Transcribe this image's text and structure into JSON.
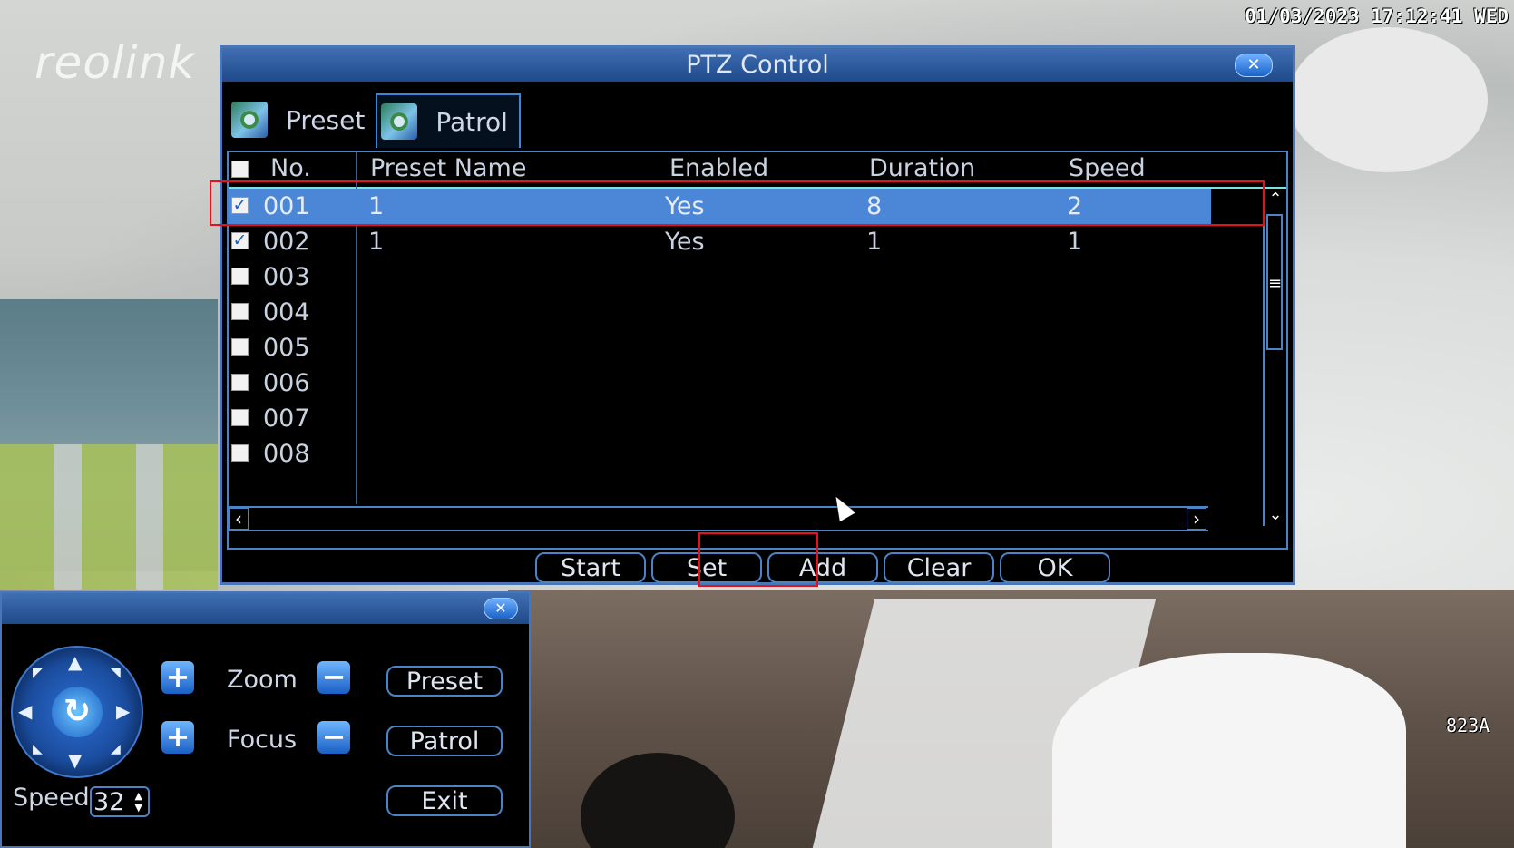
{
  "osd": {
    "datetime": "01/03/2023 17:12:41 WED",
    "camera_label": "823A",
    "watermark": "reolink"
  },
  "ptz": {
    "title": "PTZ Control",
    "close_glyph": "✕",
    "tabs": [
      {
        "label": "Preset",
        "icon": "camera-preset-icon",
        "active": false
      },
      {
        "label": "Patrol",
        "icon": "camera-patrol-icon",
        "active": true
      }
    ],
    "table": {
      "headers": {
        "no": "No.",
        "preset_name": "Preset Name",
        "enabled": "Enabled",
        "duration": "Duration",
        "speed": "Speed"
      },
      "rows": [
        {
          "no": "001",
          "preset_name": "1",
          "enabled": "Yes",
          "duration": "8",
          "speed": "2",
          "checked": true,
          "selected": true
        },
        {
          "no": "002",
          "preset_name": "1",
          "enabled": "Yes",
          "duration": "1",
          "speed": "1",
          "checked": true,
          "selected": false
        },
        {
          "no": "003",
          "preset_name": "",
          "enabled": "",
          "duration": "",
          "speed": "",
          "checked": false,
          "selected": false
        },
        {
          "no": "004",
          "preset_name": "",
          "enabled": "",
          "duration": "",
          "speed": "",
          "checked": false,
          "selected": false
        },
        {
          "no": "005",
          "preset_name": "",
          "enabled": "",
          "duration": "",
          "speed": "",
          "checked": false,
          "selected": false
        },
        {
          "no": "006",
          "preset_name": "",
          "enabled": "",
          "duration": "",
          "speed": "",
          "checked": false,
          "selected": false
        },
        {
          "no": "007",
          "preset_name": "",
          "enabled": "",
          "duration": "",
          "speed": "",
          "checked": false,
          "selected": false
        },
        {
          "no": "008",
          "preset_name": "",
          "enabled": "",
          "duration": "",
          "speed": "",
          "checked": false,
          "selected": false
        }
      ]
    },
    "buttons": {
      "start": "Start",
      "set": "Set",
      "add": "Add",
      "clear": "Clear",
      "ok": "OK"
    }
  },
  "control": {
    "close_glyph": "✕",
    "zoom_label": "Zoom",
    "focus_label": "Focus",
    "plus_glyph": "+",
    "minus_glyph": "−",
    "speed_label": "Speed",
    "speed_value": "32",
    "buttons": {
      "preset": "Preset",
      "patrol": "Patrol",
      "exit": "Exit"
    },
    "center_glyph": "↻"
  },
  "colors": {
    "accent": "#4a84c6",
    "selected_row": "#4c86d6",
    "highlight_box": "#e0141b",
    "title_bar": "#2f5fa3"
  }
}
